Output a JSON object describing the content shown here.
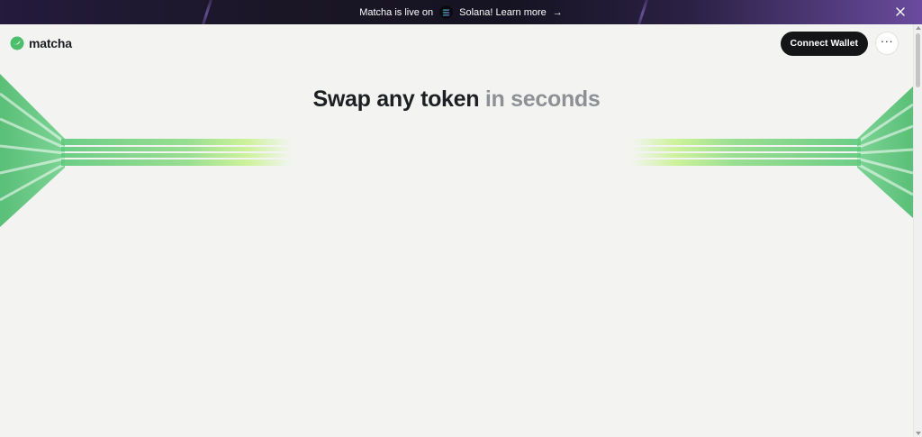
{
  "banner": {
    "text_before": "Matcha is live on",
    "text_after": "Solana! Learn more",
    "arrow": "→",
    "solana_icon": "solana-logo-icon",
    "close_icon": "close-icon",
    "background_start": "#241b3d",
    "background_end": "#6a4b9e"
  },
  "header": {
    "logo_text": "matcha",
    "logo_icon": "matcha-logo-icon",
    "connect_wallet_label": "Connect Wallet",
    "more_label": "···",
    "more_icon": "more-horizontal-icon"
  },
  "hero": {
    "title_main": "Swap any token",
    "title_muted": "in seconds"
  },
  "colors": {
    "accent_green": "#5cc97a",
    "accent_lime": "#c6f28a",
    "button_dark": "#141517",
    "page_background": "#f3f4f2",
    "muted_text": "#8e9095"
  }
}
